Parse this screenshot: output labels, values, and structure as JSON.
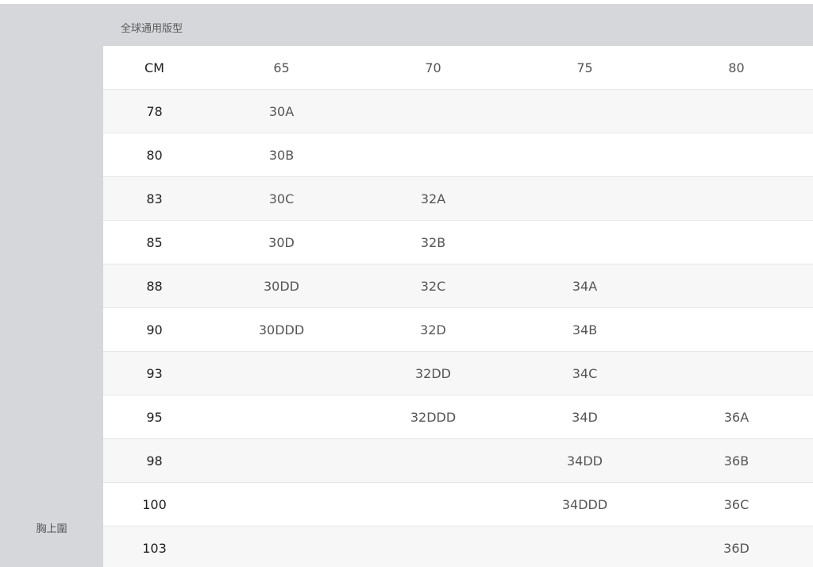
{
  "header": {
    "title": "全球通用版型"
  },
  "side_label": "胸上圍",
  "table": {
    "columns": [
      "CM",
      "65",
      "70",
      "75",
      "80"
    ],
    "rows": [
      [
        "78",
        "30A",
        "",
        "",
        ""
      ],
      [
        "80",
        "30B",
        "",
        "",
        ""
      ],
      [
        "83",
        "30C",
        "32A",
        "",
        ""
      ],
      [
        "85",
        "30D",
        "32B",
        "",
        ""
      ],
      [
        "88",
        "30DD",
        "32C",
        "34A",
        ""
      ],
      [
        "90",
        "30DDD",
        "32D",
        "34B",
        ""
      ],
      [
        "93",
        "",
        "32DD",
        "34C",
        ""
      ],
      [
        "95",
        "",
        "32DDD",
        "34D",
        "36A"
      ],
      [
        "98",
        "",
        "",
        "34DD",
        "36B"
      ],
      [
        "100",
        "",
        "",
        "34DDD",
        "36C"
      ],
      [
        "103",
        "",
        "",
        "",
        "36D"
      ]
    ]
  }
}
